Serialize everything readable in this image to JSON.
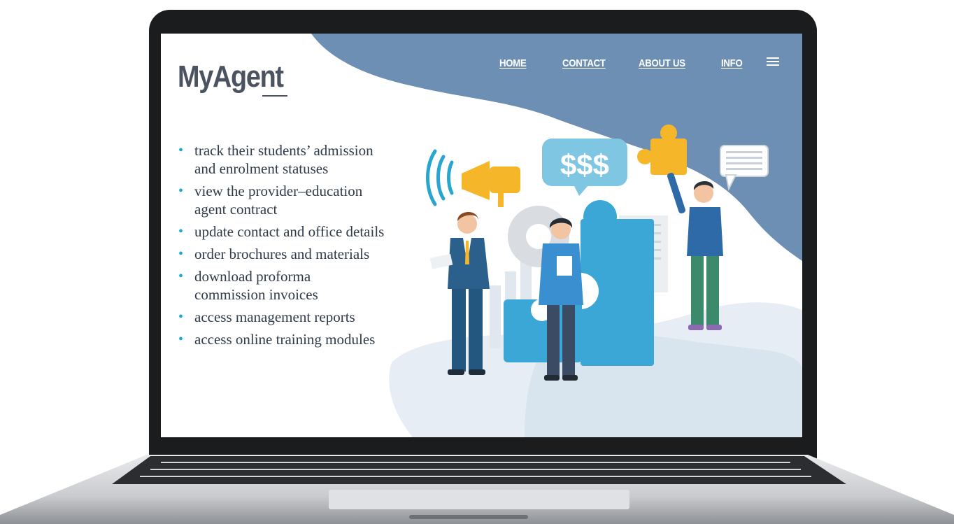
{
  "brand": {
    "logo_text": "MyAgent"
  },
  "nav": {
    "links": [
      "HOME",
      "CONTACT",
      "ABOUT US",
      "INFO"
    ],
    "menu_icon": "hamburger-menu-icon"
  },
  "features": [
    [
      "track their students’ admission",
      "and enrolment statuses"
    ],
    [
      "view the provider–education",
      "agent contract"
    ],
    [
      "update contact and office details"
    ],
    [
      "order brochures and materials"
    ],
    [
      "download proforma",
      "commission invoices"
    ],
    [
      "access management reports"
    ],
    [
      "access online training modules"
    ]
  ],
  "illustration": {
    "money_bubble_text": "$$$"
  },
  "colors": {
    "header_blue": "#6d8fb4",
    "bullet_teal": "#22a9c7",
    "logo_gray": "#4b5360",
    "puzzle_blue": "#3aa7d6",
    "puzzle_yellow": "#f5b62a"
  }
}
